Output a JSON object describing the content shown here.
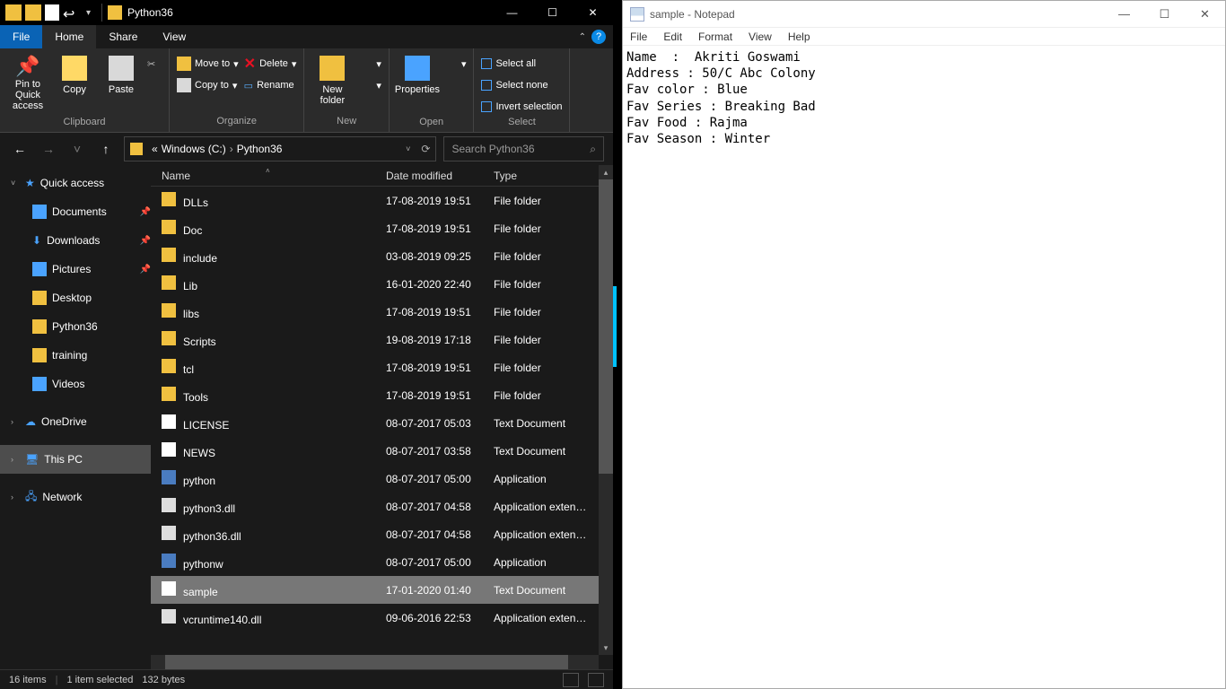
{
  "explorer": {
    "title": "Python36",
    "tabs": {
      "file": "File",
      "home": "Home",
      "share": "Share",
      "view": "View"
    },
    "ribbon": {
      "clipboard": {
        "pin": "Pin to Quick access",
        "copy": "Copy",
        "paste": "Paste",
        "label": "Clipboard"
      },
      "organize": {
        "move": "Move to",
        "copy": "Copy to",
        "delete": "Delete",
        "rename": "Rename",
        "label": "Organize"
      },
      "new": {
        "folder": "New folder",
        "label": "New"
      },
      "open": {
        "props": "Properties",
        "label": "Open"
      },
      "select": {
        "all": "Select all",
        "none": "Select none",
        "invert": "Invert selection",
        "label": "Select"
      }
    },
    "address": {
      "seg1": "«",
      "seg2": "Windows (C:)",
      "seg3": "Python36"
    },
    "search_placeholder": "Search Python36",
    "nav": {
      "quick": "Quick access",
      "items": [
        {
          "label": "Documents"
        },
        {
          "label": "Downloads"
        },
        {
          "label": "Pictures"
        },
        {
          "label": "Desktop"
        },
        {
          "label": "Python36"
        },
        {
          "label": "training"
        },
        {
          "label": "Videos"
        }
      ],
      "onedrive": "OneDrive",
      "thispc": "This PC",
      "network": "Network"
    },
    "columns": {
      "name": "Name",
      "date": "Date modified",
      "type": "Type"
    },
    "files": [
      {
        "name": "DLLs",
        "date": "17-08-2019 19:51",
        "type": "File folder",
        "ico": "ico-folder"
      },
      {
        "name": "Doc",
        "date": "17-08-2019 19:51",
        "type": "File folder",
        "ico": "ico-folder"
      },
      {
        "name": "include",
        "date": "03-08-2019 09:25",
        "type": "File folder",
        "ico": "ico-folder"
      },
      {
        "name": "Lib",
        "date": "16-01-2020 22:40",
        "type": "File folder",
        "ico": "ico-folder"
      },
      {
        "name": "libs",
        "date": "17-08-2019 19:51",
        "type": "File folder",
        "ico": "ico-folder"
      },
      {
        "name": "Scripts",
        "date": "19-08-2019 17:18",
        "type": "File folder",
        "ico": "ico-folder"
      },
      {
        "name": "tcl",
        "date": "17-08-2019 19:51",
        "type": "File folder",
        "ico": "ico-folder"
      },
      {
        "name": "Tools",
        "date": "17-08-2019 19:51",
        "type": "File folder",
        "ico": "ico-folder"
      },
      {
        "name": "LICENSE",
        "date": "08-07-2017 05:03",
        "type": "Text Document",
        "ico": "ico-text"
      },
      {
        "name": "NEWS",
        "date": "08-07-2017 03:58",
        "type": "Text Document",
        "ico": "ico-text"
      },
      {
        "name": "python",
        "date": "08-07-2017 05:00",
        "type": "Application",
        "ico": "ico-exe"
      },
      {
        "name": "python3.dll",
        "date": "08-07-2017 04:58",
        "type": "Application exten…",
        "ico": "ico-dll"
      },
      {
        "name": "python36.dll",
        "date": "08-07-2017 04:58",
        "type": "Application exten…",
        "ico": "ico-dll"
      },
      {
        "name": "pythonw",
        "date": "08-07-2017 05:00",
        "type": "Application",
        "ico": "ico-exe"
      },
      {
        "name": "sample",
        "date": "17-01-2020 01:40",
        "type": "Text Document",
        "ico": "ico-text",
        "sel": true
      },
      {
        "name": "vcruntime140.dll",
        "date": "09-06-2016 22:53",
        "type": "Application exten…",
        "ico": "ico-dll"
      }
    ],
    "status": {
      "count": "16 items",
      "selected": "1 item selected",
      "size": "132 bytes"
    }
  },
  "notepad": {
    "title": "sample - Notepad",
    "menu": {
      "file": "File",
      "edit": "Edit",
      "format": "Format",
      "view": "View",
      "help": "Help"
    },
    "content": "Name  :  Akriti Goswami\nAddress : 50/C Abc Colony\nFav color : Blue\nFav Series : Breaking Bad\nFav Food : Rajma\nFav Season : Winter"
  }
}
